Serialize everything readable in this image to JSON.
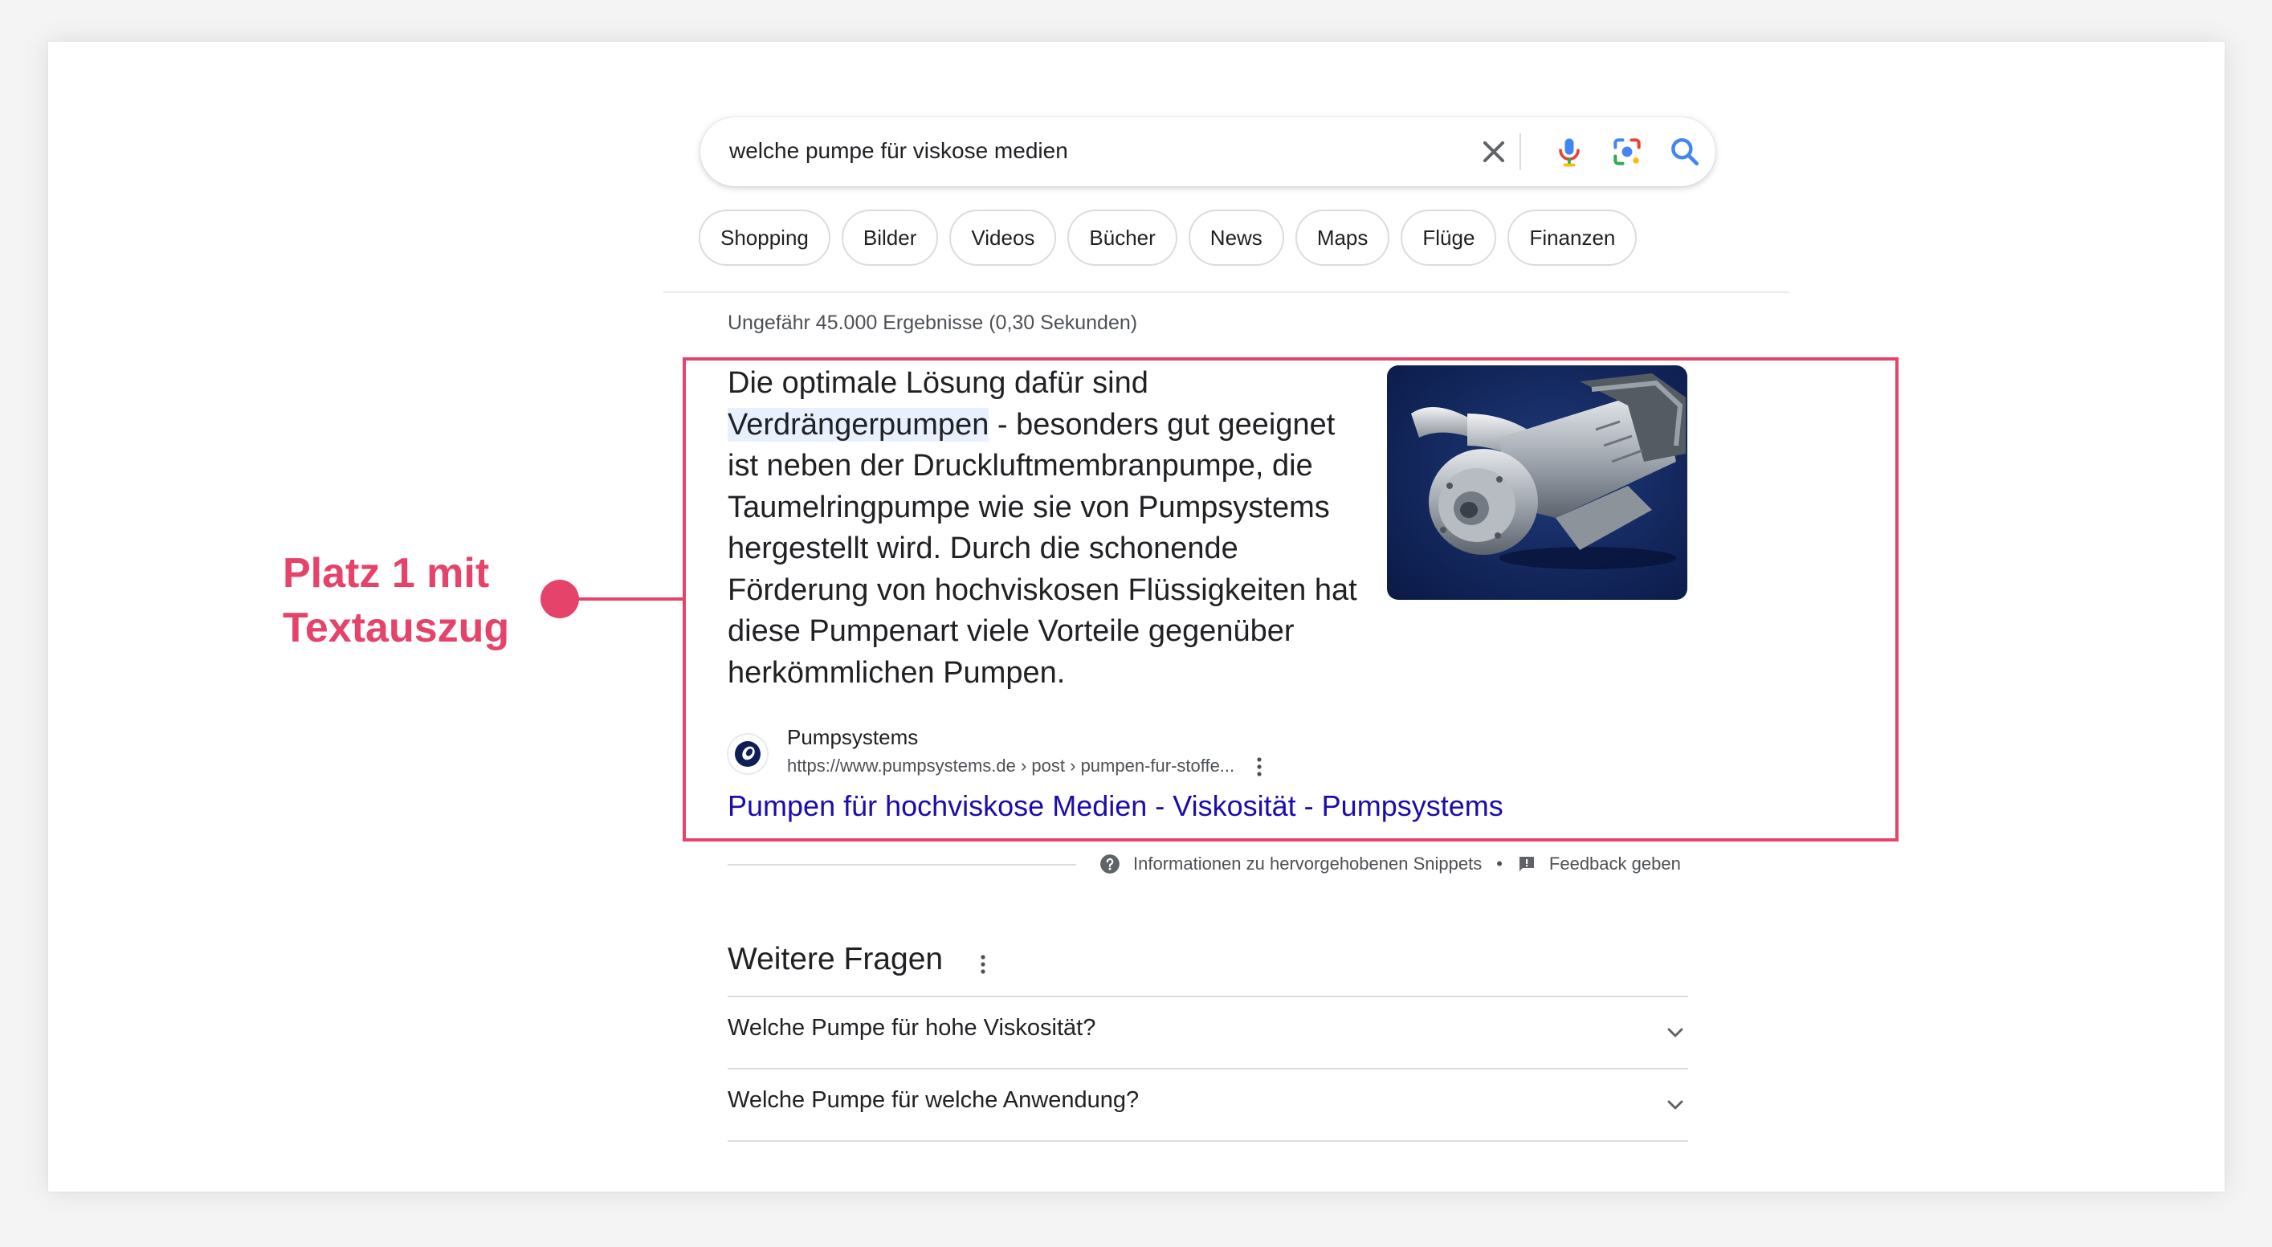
{
  "search": {
    "query": "welche pumpe für viskose medien"
  },
  "chips": [
    "Shopping",
    "Bilder",
    "Videos",
    "Bücher",
    "News",
    "Maps",
    "Flüge",
    "Finanzen"
  ],
  "result_stats": "Ungefähr 45.000 Ergebnisse (0,30 Sekunden)",
  "snippet": {
    "text_before": "Die optimale Lösung dafür sind ",
    "highlight": "Verdrängerpumpen",
    "text_after": " - besonders gut geeignet ist neben der Druckluftmembranpumpe, die Taumelringpumpe wie sie von Pumpsystems hergestellt wird. Durch die schonende Förderung von hochviskosen Flüssigkeiten hat diese Pumpenart viele Vorteile gegenüber herkömmlichen Pumpen.",
    "site_name": "Pumpsystems",
    "url": "https://www.pumpsystems.de › post › pumpen-fur-stoffe...",
    "title": "Pumpen für hochviskose Medien - Viskosität - Pumpsystems"
  },
  "footer": {
    "info": "Informationen zu hervorgehobenen Snippets",
    "separator": "•",
    "feedback": "Feedback geben"
  },
  "paa": {
    "title": "Weitere Fragen",
    "questions": [
      "Welche Pumpe für hohe Viskosität?",
      "Welche Pumpe für welche Anwendung?"
    ]
  },
  "annotation": {
    "line1": "Platz 1 mit",
    "line2": "Textauszug"
  },
  "colors": {
    "accent": "#e5436a",
    "link": "#1a0dab",
    "highlight_bg": "#e8f0fe"
  }
}
